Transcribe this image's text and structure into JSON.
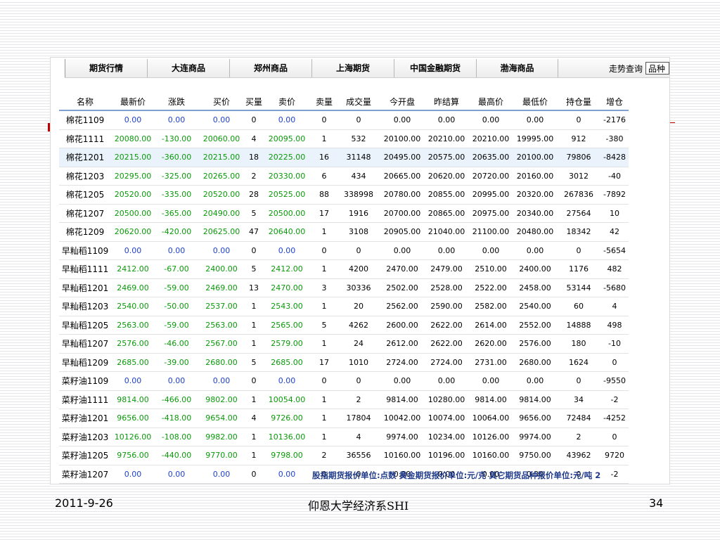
{
  "tabs": [
    "期货行情",
    "大连商品",
    "郑州商品",
    "上海期货",
    "中国金融期货",
    "渤海商品"
  ],
  "trend": {
    "label": "走势查询",
    "input_value": "品种"
  },
  "table": {
    "headers": [
      "名称",
      "最新价",
      "涨跌",
      "买价",
      "买量",
      "卖价",
      "卖量",
      "成交量",
      "今开盘",
      "昨结算",
      "最高价",
      "最低价",
      "持仓量",
      "增仓"
    ],
    "rows": [
      [
        "棉花1109",
        "0.00",
        "0.00",
        "0.00",
        "0",
        "0.00",
        "0",
        "0",
        "0.00",
        "0.00",
        "0.00",
        "0.00",
        "0",
        "-2176"
      ],
      [
        "棉花1111",
        "20080.00",
        "-130.00",
        "20060.00",
        "4",
        "20095.00",
        "1",
        "532",
        "20100.00",
        "20210.00",
        "20210.00",
        "19995.00",
        "912",
        "-380"
      ],
      [
        "棉花1201",
        "20215.00",
        "-360.00",
        "20215.00",
        "18",
        "20225.00",
        "16",
        "31148",
        "20495.00",
        "20575.00",
        "20635.00",
        "20100.00",
        "79806",
        "-8428"
      ],
      [
        "棉花1203",
        "20295.00",
        "-325.00",
        "20265.00",
        "2",
        "20330.00",
        "6",
        "434",
        "20665.00",
        "20620.00",
        "20720.00",
        "20160.00",
        "3012",
        "-40"
      ],
      [
        "棉花1205",
        "20520.00",
        "-335.00",
        "20520.00",
        "28",
        "20525.00",
        "88",
        "338998",
        "20780.00",
        "20855.00",
        "20995.00",
        "20320.00",
        "267836",
        "-7892"
      ],
      [
        "棉花1207",
        "20500.00",
        "-365.00",
        "20490.00",
        "5",
        "20500.00",
        "17",
        "1916",
        "20700.00",
        "20865.00",
        "20975.00",
        "20340.00",
        "27564",
        "10"
      ],
      [
        "棉花1209",
        "20620.00",
        "-420.00",
        "20625.00",
        "47",
        "20640.00",
        "1",
        "3108",
        "20905.00",
        "21040.00",
        "21100.00",
        "20480.00",
        "18342",
        "42"
      ],
      [
        "早籼稻1109",
        "0.00",
        "0.00",
        "0.00",
        "0",
        "0.00",
        "0",
        "0",
        "0.00",
        "0.00",
        "0.00",
        "0.00",
        "0",
        "-5654"
      ],
      [
        "早籼稻1111",
        "2412.00",
        "-67.00",
        "2400.00",
        "5",
        "2412.00",
        "1",
        "4200",
        "2470.00",
        "2479.00",
        "2510.00",
        "2400.00",
        "1176",
        "482"
      ],
      [
        "早籼稻1201",
        "2469.00",
        "-59.00",
        "2469.00",
        "13",
        "2470.00",
        "3",
        "30336",
        "2502.00",
        "2528.00",
        "2522.00",
        "2458.00",
        "53144",
        "-5680"
      ],
      [
        "早籼稻1203",
        "2540.00",
        "-50.00",
        "2537.00",
        "1",
        "2543.00",
        "1",
        "20",
        "2562.00",
        "2590.00",
        "2582.00",
        "2540.00",
        "60",
        "4"
      ],
      [
        "早籼稻1205",
        "2563.00",
        "-59.00",
        "2563.00",
        "1",
        "2565.00",
        "5",
        "4262",
        "2600.00",
        "2622.00",
        "2614.00",
        "2552.00",
        "14888",
        "498"
      ],
      [
        "早籼稻1207",
        "2576.00",
        "-46.00",
        "2567.00",
        "1",
        "2579.00",
        "1",
        "24",
        "2612.00",
        "2622.00",
        "2620.00",
        "2576.00",
        "180",
        "-10"
      ],
      [
        "早籼稻1209",
        "2685.00",
        "-39.00",
        "2680.00",
        "5",
        "2685.00",
        "17",
        "1010",
        "2724.00",
        "2724.00",
        "2731.00",
        "2680.00",
        "1624",
        "0"
      ],
      [
        "菜籽油1109",
        "0.00",
        "0.00",
        "0.00",
        "0",
        "0.00",
        "0",
        "0",
        "0.00",
        "0.00",
        "0.00",
        "0.00",
        "0",
        "-9550"
      ],
      [
        "菜籽油1111",
        "9814.00",
        "-466.00",
        "9802.00",
        "1",
        "10054.00",
        "1",
        "2",
        "9814.00",
        "10280.00",
        "9814.00",
        "9814.00",
        "34",
        "-2"
      ],
      [
        "菜籽油1201",
        "9656.00",
        "-418.00",
        "9654.00",
        "4",
        "9726.00",
        "1",
        "17804",
        "10042.00",
        "10074.00",
        "10064.00",
        "9656.00",
        "72484",
        "-4252"
      ],
      [
        "菜籽油1203",
        "10126.00",
        "-108.00",
        "9982.00",
        "1",
        "10136.00",
        "1",
        "4",
        "9974.00",
        "10234.00",
        "10126.00",
        "9974.00",
        "2",
        "0"
      ],
      [
        "菜籽油1205",
        "9756.00",
        "-440.00",
        "9770.00",
        "1",
        "9798.00",
        "2",
        "36556",
        "10160.00",
        "10196.00",
        "10160.00",
        "9750.00",
        "43962",
        "9720"
      ],
      [
        "菜籽油1207",
        "0.00",
        "0.00",
        "0.00",
        "0",
        "0.00",
        "0",
        "0",
        "0.00",
        "0.00",
        "0.00",
        "0.00",
        "0",
        "-2"
      ]
    ],
    "highlighted_row": 2
  },
  "note": "股指期货报价单位:点数 黄金期货报价单位:元/克 其它期货品种报价单位:元/吨 2",
  "colors": {
    "zero_price": "#1f3fd0",
    "traded_price": "#0a9a0a",
    "header_rule": "#7fa0d0",
    "highlight_row": "#eaf3fb"
  },
  "footer": {
    "date": "2011-9-26",
    "center": "仰恩大学经济系SHI",
    "page": "34"
  }
}
